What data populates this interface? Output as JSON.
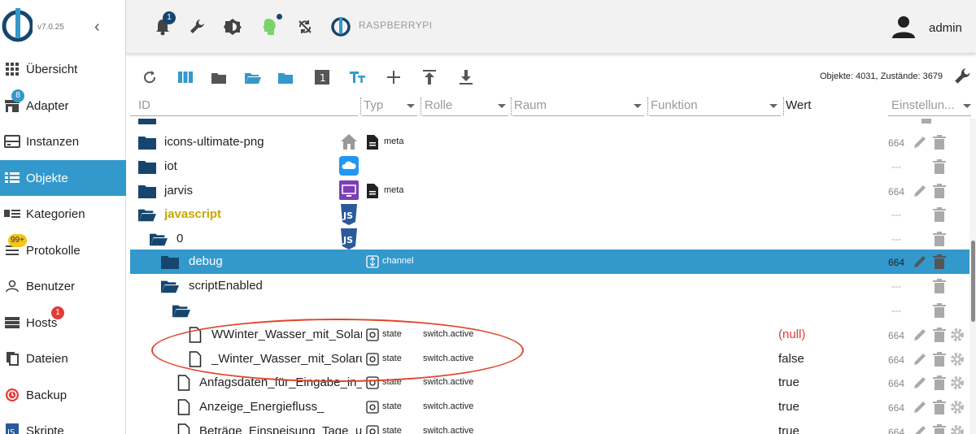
{
  "app": {
    "version": "v7.0.25",
    "hostname": "RASPBERRYPI",
    "username": "admin"
  },
  "sidebar": {
    "items": [
      {
        "label": "Übersicht",
        "icon": "grid-icon"
      },
      {
        "label": "Adapter",
        "icon": "store-icon",
        "badge": "8",
        "badge_color": "#3399cc"
      },
      {
        "label": "Instanzen",
        "icon": "instances-icon"
      },
      {
        "label": "Objekte",
        "icon": "list-icon",
        "active": true
      },
      {
        "label": "Kategorien",
        "icon": "categories-icon"
      },
      {
        "label": "Protokolle",
        "icon": "log-icon",
        "badge": "99+",
        "badge_color": "#f5c518"
      },
      {
        "label": "Benutzer",
        "icon": "user-icon"
      },
      {
        "label": "Hosts",
        "icon": "hosts-icon",
        "badge": "1",
        "badge_color": "#e53935"
      },
      {
        "label": "Dateien",
        "icon": "files-icon"
      },
      {
        "label": "Backup",
        "icon": "backup-icon"
      },
      {
        "label": "Skripte",
        "icon": "scripts-icon"
      }
    ]
  },
  "topbar": {
    "notification_count": "1"
  },
  "toolbar": {
    "counts": "Objekte: 4031, Zustände: 3679"
  },
  "columns": {
    "id": "ID",
    "type": "Typ",
    "role": "Rolle",
    "room": "Raum",
    "function": "Funktion",
    "value": "Wert",
    "settings": "Einstellun..."
  },
  "rows": [
    {
      "name": "icons-ultimate-png",
      "type": "meta",
      "acl": "664"
    },
    {
      "name": "iot",
      "acl": "---"
    },
    {
      "name": "jarvis",
      "type": "meta",
      "acl": "664"
    },
    {
      "name": "javascript",
      "acl": "---"
    },
    {
      "name": "0",
      "acl": "---"
    },
    {
      "name": "debug",
      "type": "channel",
      "acl": "664"
    },
    {
      "name": "scriptEnabled",
      "acl": "---"
    },
    {
      "name": "",
      "acl": "---"
    },
    {
      "name": "WWinter_Wasser_mit_Soları",
      "type": "state",
      "role": "switch.active",
      "value": "(null)",
      "acl": "664"
    },
    {
      "name": "_Winter_Wasser_mit_Solaru",
      "type": "state",
      "role": "switch.active",
      "value": "false",
      "acl": "664"
    },
    {
      "name": "Anfagsdaten_für_Eingabe_in_I",
      "type": "state",
      "role": "switch.active",
      "value": "true",
      "acl": "664"
    },
    {
      "name": "Anzeige_Energiefluss_",
      "type": "state",
      "role": "switch.active",
      "value": "true",
      "acl": "664"
    },
    {
      "name": "Beträge_Einspeisung_Tage_un",
      "type": "state",
      "role": "switch.active",
      "value": "true",
      "acl": "664"
    }
  ]
}
